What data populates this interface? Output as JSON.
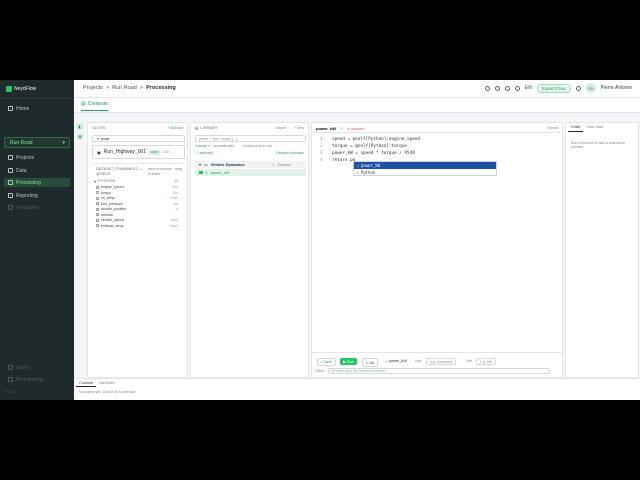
{
  "app": {
    "name": "NeydFlow"
  },
  "sidebar": {
    "home": "Home",
    "project": "Run Road",
    "items": [
      {
        "label": "Projects"
      },
      {
        "label": "Data"
      },
      {
        "label": "Processing"
      },
      {
        "label": "Reporting"
      },
      {
        "label": "Templates"
      }
    ],
    "footer_items": [
      {
        "label": "Users"
      },
      {
        "label": "Permissions"
      }
    ],
    "version": "v0.0.1"
  },
  "breadcrumb": {
    "a": "Projects",
    "sep": ">",
    "b": "Run Road",
    "c": "Processing"
  },
  "topbar": {
    "lang": "EN",
    "expert": "Expert Flow",
    "user": "Pierre Antoine",
    "initials": "PA"
  },
  "tabs": {
    "compute": "Compute"
  },
  "slots": {
    "title": "SLOTS",
    "add": "+ Add slot",
    "input_value": "post",
    "slot_name": "Run_Highway_001",
    "slot_badge": "used",
    "slot_meta": "0.2h",
    "channels_title": "DATASET CHANNELS — @SELF",
    "channels_hint": "click to preview · drag to editor",
    "group": "PYTHON",
    "group_count": "10",
    "channels": [
      {
        "name": "engine_speed",
        "unit": "rpm"
      },
      {
        "name": "torque",
        "unit": "Nm"
      },
      {
        "name": "oil_temp",
        "unit": "degC"
      },
      {
        "name": "fuel_pressure",
        "unit": "bar"
      },
      {
        "name": "throttle_position",
        "unit": "%"
      },
      {
        "name": "lambda",
        "unit": ""
      },
      {
        "name": "vehicle_speed",
        "unit": "km/h"
      },
      {
        "name": "exhaust_temp",
        "unit": "degC"
      }
    ]
  },
  "library": {
    "title": "LIBRARY",
    "import": "Import",
    "new": "+ New",
    "search_placeholder": "power / \"rpm\" torque [...]",
    "hint_a": "Indicate a · separate with ,",
    "hint_b": "double-click to use",
    "selected": "1 selected",
    "deselect": "Deselect formulas",
    "group": "Vehicle Dynamics",
    "group_count": "1",
    "group_actions": "Rename",
    "formula": "power_kW"
  },
  "editor": {
    "formula_name": "power_kW",
    "status": "● Unsaved",
    "format": "Format",
    "lines": [
      {
        "n": "1",
        "text": "speed = @self[Python]:engine_speed"
      },
      {
        "n": "2",
        "text": "torque = @self[Python]:torque"
      },
      {
        "n": "3",
        "text": "power_kW = speed * torque / 9549"
      },
      {
        "n": "4",
        "text": "return po"
      }
    ],
    "autocomplete": [
      "power_kW",
      "Python"
    ],
    "save": "Save",
    "run": "Run",
    "run_all": "All",
    "output_label": "→ power_kW",
    "unit_label": "Unit",
    "unit_placeholder": "e.g. computed",
    "desc_label": "Desc",
    "desc_placeholder": "Describe what this formula computes...",
    "type_label": "Unit",
    "type_placeholder": "e.g. kW"
  },
  "right_panel": {
    "tab_chart": "Chart",
    "tab_raw": "Raw data",
    "hint": "Run a formula or click a channel to preview."
  },
  "console": {
    "tab_console": "Console",
    "tab_variables": "Variables",
    "message": "No output yet. Click Run to execute."
  },
  "colors": {
    "accent": "#22c55e",
    "sidebar_bg": "#1f2a2c",
    "selection": "#1e50a8"
  }
}
